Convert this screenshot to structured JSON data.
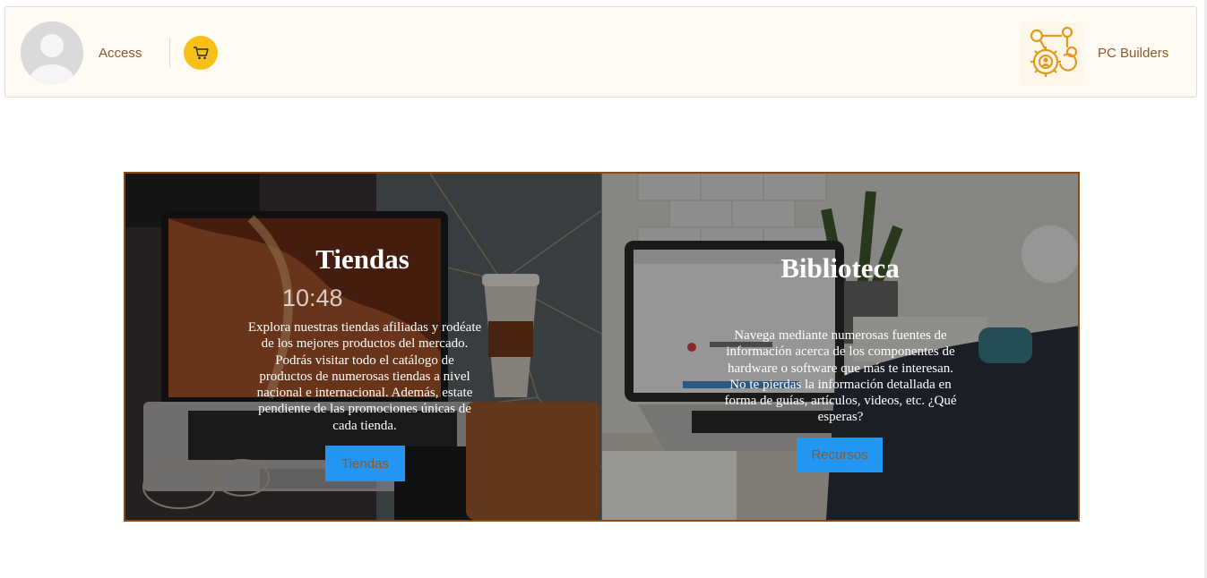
{
  "header": {
    "access_label": "Access",
    "brand_name": "PC Builders",
    "icons": {
      "avatar": "user-avatar-icon",
      "cart": "shopping-cart-icon",
      "logo": "gear-network-logo-icon"
    }
  },
  "panels": [
    {
      "title": "Tiendas",
      "text": "Explora nuestras tiendas afiliadas y rodéate de los mejores productos del mercado. Podrás visitar todo el catálogo de productos de numerosas tiendas a nivel nacional e internacional. Además, estate pendiente de las promociones únicas de cada tienda.",
      "button_label": "Tiendas",
      "screen_time": "10:48"
    },
    {
      "title": "Biblioteca",
      "text": "Navega mediante numerosas fuentes de información acerca de los componentes de hardware o software que más te interesan. No te pierdas la información detallada en forma de guías, artículos, videos, etc. ¿Qué esperas?",
      "button_label": "Recursos"
    }
  ],
  "colors": {
    "header_bg": "#fffbf3",
    "accent_brown": "#8a5a2b",
    "cart_yellow": "#f6c018",
    "button_blue": "#2395f3",
    "panel_border": "#8b4a12"
  }
}
